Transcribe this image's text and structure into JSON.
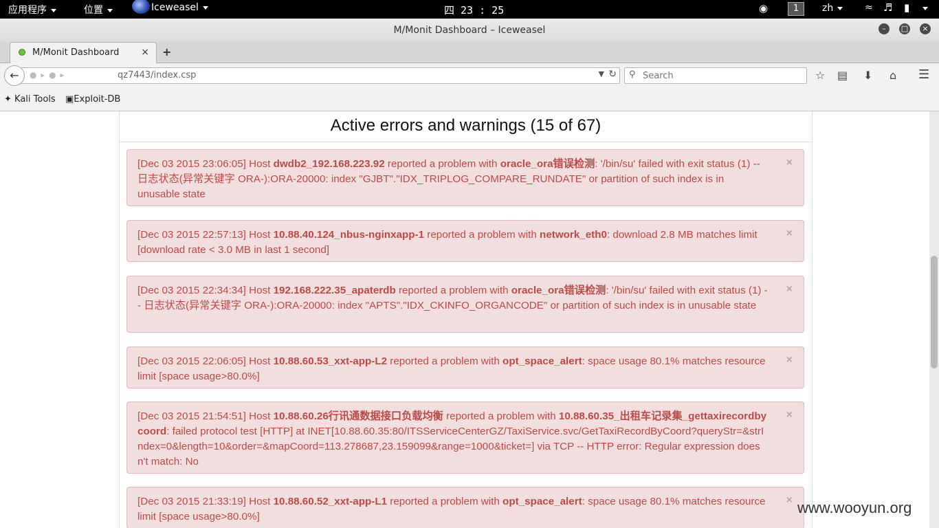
{
  "topbar": {
    "applications": "应用程序",
    "places": "位置",
    "app_name": "Iceweasel",
    "clock": "四 23 : 25",
    "workspace": "1",
    "language": "zh"
  },
  "window": {
    "title": "M/Monit Dashboard – Iceweasel"
  },
  "tab": {
    "label": "M/Monit Dashboard",
    "close": "×",
    "new_tab": "+"
  },
  "nav": {
    "url": "qz7443/index.csp",
    "search_placeholder": "Search"
  },
  "bookmarks": [
    {
      "label": "Kali Tools"
    },
    {
      "label": "Exploit-DB"
    }
  ],
  "panel": {
    "title": "Active errors and warnings (15 of 67)"
  },
  "alerts": [
    {
      "time": "[Dec 03 2015 23:06:05] Host ",
      "host": "dwdb2_192.168.223.92",
      "mid": " reported a problem with ",
      "service": "oracle_ora错误检测",
      "message": ": '/bin/su' failed with exit status (1) -- 日志状态(异常关键字 ORA-):ORA-20000: index \"GJBT\".\"IDX_TRIPLOG_COMPARE_RUNDATE\" or partition of such index is in unusable state"
    },
    {
      "time": "[Dec 03 2015 22:57:13] Host ",
      "host": "10.88.40.124_nbus-nginxapp-1",
      "mid": " reported a problem with ",
      "service": "network_eth0",
      "message": ": download 2.8 MB matches limit [download rate < 3.0 MB in last 1 second]"
    },
    {
      "time": "[Dec 03 2015 22:34:34] Host ",
      "host": "192.168.222.35_apaterdb",
      "mid": " reported a problem with ",
      "service": "oracle_ora错误检测",
      "message": ": '/bin/su' failed with exit status (1) -- 日志状态(异常关键字 ORA-):ORA-20000: index \"APTS\".\"IDX_CKINFO_ORGANCODE\" or partition of such index is in unusable state"
    },
    {
      "time": "[Dec 03 2015 22:06:05] Host ",
      "host": "10.88.60.53_xxt-app-L2",
      "mid": " reported a problem with ",
      "service": "opt_space_alert",
      "message": ": space usage 80.1% matches resource limit [space usage>80.0%]"
    },
    {
      "time": "[Dec 03 2015 21:54:51] Host ",
      "host": "10.88.60.26行讯通数据接口负载均衡",
      "mid": " reported a problem with ",
      "service": "10.88.60.35_出租车记录集_gettaxirecordbycoord",
      "message": ": failed protocol test [HTTP] at INET[10.88.60.35:80/ITSServiceCenterGZ/TaxiService.svc/GetTaxiRecordByCoord?queryStr=&strIndex=0&length=10&order=&mapCoord=113.278687,23.159099&range=1000&ticket=] via TCP -- HTTP error: Regular expression doesn't match: No"
    },
    {
      "time": "[Dec 03 2015 21:33:19] Host ",
      "host": "10.88.60.52_xxt-app-L1",
      "mid": " reported a problem with ",
      "service": "opt_space_alert",
      "message": ": space usage 80.1% matches resource limit [space usage>80.0%]"
    }
  ],
  "alert_close": "×",
  "watermark": "www.wooyun.org"
}
